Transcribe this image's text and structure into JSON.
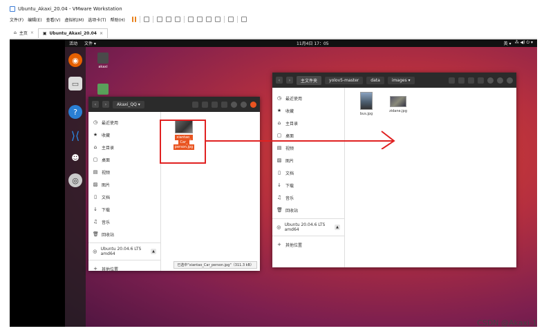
{
  "window": {
    "title": "Ubuntu_Akaxi_20.04 - VMware Workstation"
  },
  "vm_menu": [
    "文件(F)",
    "编辑(E)",
    "查看(V)",
    "虚拟机(M)",
    "选项卡(T)",
    "帮助(H)"
  ],
  "vm_tabs": [
    {
      "label": "主页",
      "active": false
    },
    {
      "label": "Ubuntu_Akaxi_20.04",
      "active": true
    }
  ],
  "topbar": {
    "activities": "活动",
    "files_menu": "文件 ▾",
    "clock": "11月4日 17：05",
    "input_method": "英 ▾",
    "status_icons": "⁂ ◀) ⏻ ▾"
  },
  "desktop_icons": [
    {
      "label": "akaxi"
    }
  ],
  "fm_left": {
    "path": "Akaxi_QQ",
    "sidebar": [
      {
        "icon": "◷",
        "label": "最近使用"
      },
      {
        "icon": "★",
        "label": "收藏"
      },
      {
        "icon": "⌂",
        "label": "主目录"
      },
      {
        "icon": "▢",
        "label": "桌面"
      },
      {
        "icon": "▤",
        "label": "视频"
      },
      {
        "icon": "▨",
        "label": "图片"
      },
      {
        "icon": "▯",
        "label": "文档"
      },
      {
        "icon": "↓",
        "label": "下载"
      },
      {
        "icon": "♫",
        "label": "音乐"
      },
      {
        "icon": "🗑",
        "label": "回收站"
      }
    ],
    "drive": "Ubuntu 20.04.6 LTS amd64",
    "eject": "▲",
    "other_places": "其他位置",
    "file": {
      "name": "xiantao_Car_person.jpg",
      "label_lines": [
        "xiantao_",
        "Car_",
        "person.jpg"
      ]
    },
    "status": "已选中\"xiantao_Car_person.jpg\"（311.3 kB）"
  },
  "fm_right": {
    "path": [
      "主文件夹",
      "yolov5-master",
      "data",
      "images ▾"
    ],
    "sidebar": [
      {
        "icon": "◷",
        "label": "最近使用"
      },
      {
        "icon": "★",
        "label": "收藏"
      },
      {
        "icon": "⌂",
        "label": "主目录"
      },
      {
        "icon": "▢",
        "label": "桌面"
      },
      {
        "icon": "▤",
        "label": "视频"
      },
      {
        "icon": "▨",
        "label": "图片"
      },
      {
        "icon": "▯",
        "label": "文档"
      },
      {
        "icon": "↓",
        "label": "下载"
      },
      {
        "icon": "♫",
        "label": "音乐"
      },
      {
        "icon": "🗑",
        "label": "回收站"
      }
    ],
    "drive": "Ubuntu 20.04.6 LTS amd64",
    "eject": "▲",
    "other_places": "其他位置",
    "files": [
      {
        "name": "bus.jpg"
      },
      {
        "name": "zidane.jpg"
      }
    ]
  },
  "watermark": "CSDN @Akaxi-1"
}
